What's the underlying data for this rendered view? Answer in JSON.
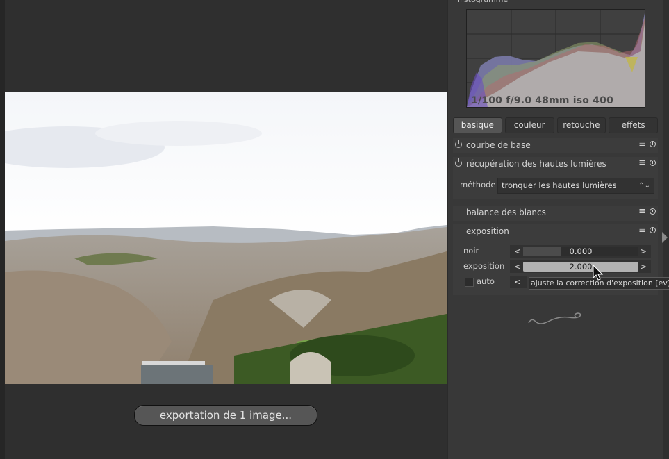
{
  "histogram": {
    "title": "histogramme",
    "exif_info": "1/100 f/9.0 48mm iso 400"
  },
  "tabs": [
    {
      "label": "basique",
      "active": true
    },
    {
      "label": "couleur",
      "active": false
    },
    {
      "label": "retouche",
      "active": false
    },
    {
      "label": "effets",
      "active": false
    }
  ],
  "modules": {
    "base_curve": {
      "name": "courbe de base"
    },
    "highlight_recovery": {
      "name": "récupération des hautes lumières",
      "method_label": "méthode",
      "method_value": "tronquer les hautes lumières"
    },
    "white_balance": {
      "name": "balance des blancs"
    },
    "exposure": {
      "name": "exposition",
      "black": {
        "label": "noir",
        "value": "0.000",
        "level": 0.0
      },
      "exposure": {
        "label": "exposition",
        "value": "2.000",
        "level": 1.0
      },
      "auto": {
        "label": "auto",
        "checked": false
      },
      "tooltip": "ajuste la correction d'exposition [ev]"
    }
  },
  "slider_arrows": {
    "left": "<",
    "right": ">"
  },
  "icons": {
    "menu": "≡",
    "combo_arrows": "⌃⌄"
  },
  "export_toast": "exportation de 1 image...",
  "colors": {
    "panel_bg": "#383838",
    "module_bg": "#3c3c3c",
    "center_bg": "#2f2f2f",
    "active_tab": "#555555",
    "slider_fill_hover": "#b2b2b2"
  }
}
